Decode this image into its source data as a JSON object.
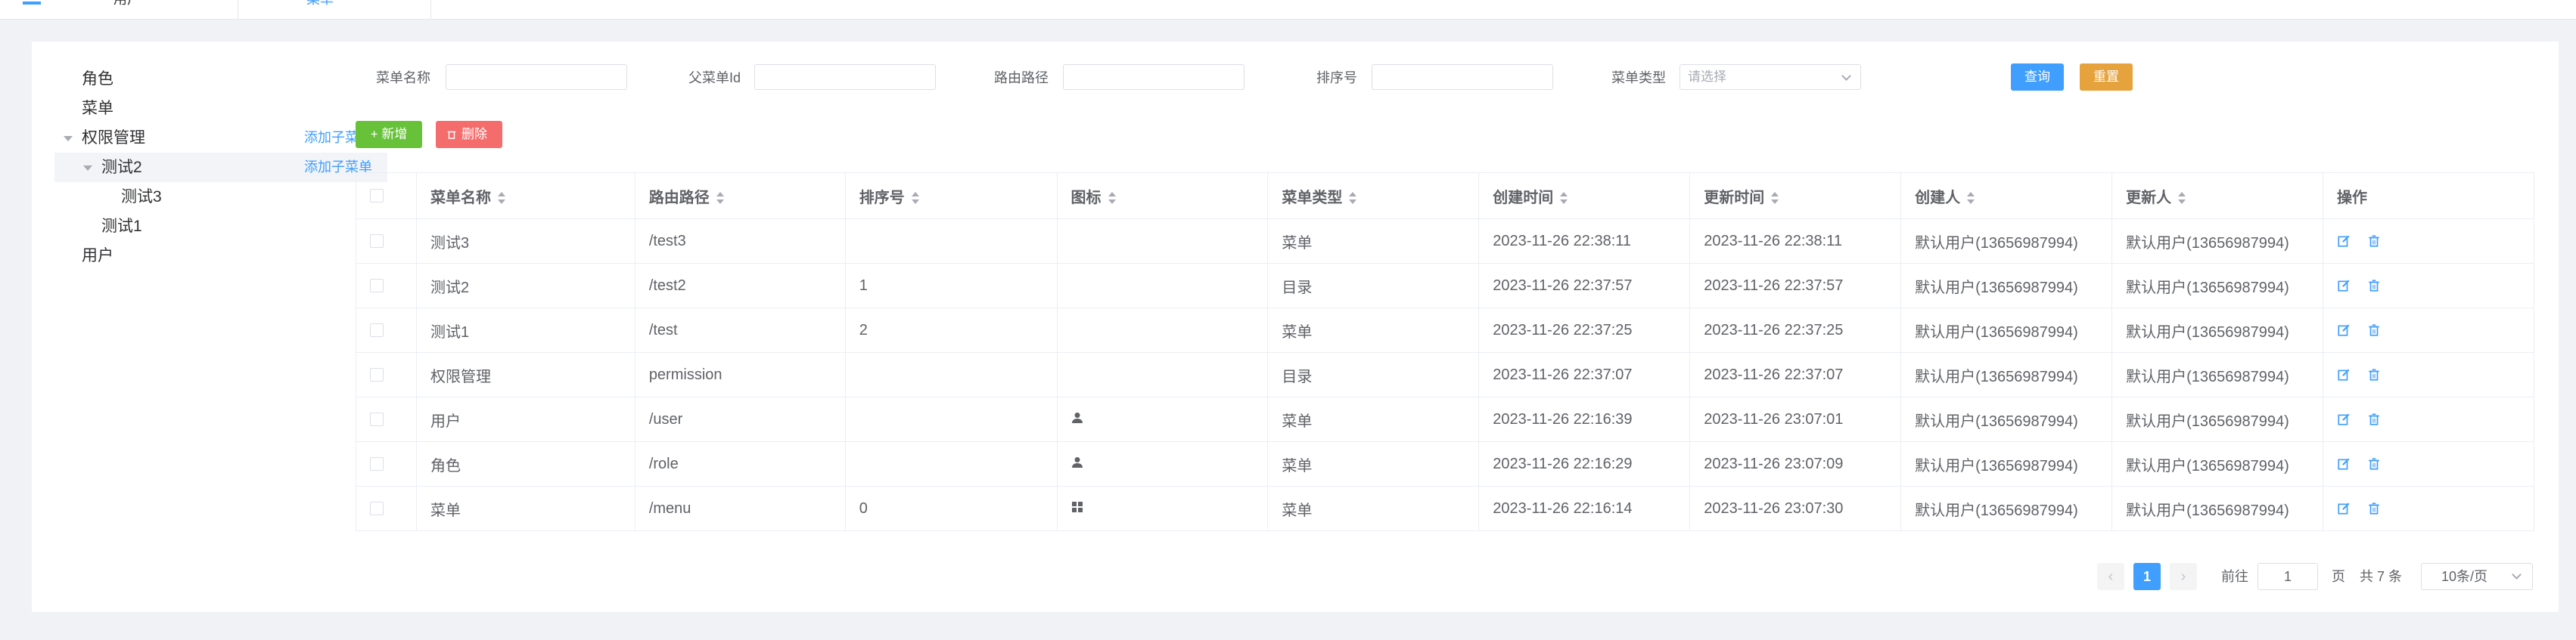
{
  "tabs": [
    {
      "label": "用户"
    },
    {
      "label": "菜单"
    }
  ],
  "tree": {
    "add_child_label": "添加子菜单",
    "nodes": [
      {
        "label": "角色"
      },
      {
        "label": "菜单"
      },
      {
        "label": "权限管理"
      },
      {
        "label": "测试2"
      },
      {
        "label": "测试3"
      },
      {
        "label": "测试1"
      },
      {
        "label": "用户"
      }
    ]
  },
  "filters": {
    "menu_name_label": "菜单名称",
    "parent_id_label": "父菜单Id",
    "route_label": "路由路径",
    "sort_label": "排序号",
    "type_label": "菜单类型",
    "type_placeholder": "请选择",
    "menu_name_value": "",
    "parent_id_value": "",
    "route_value": "",
    "sort_value": ""
  },
  "buttons": {
    "query": "查询",
    "reset": "重置",
    "add": "+ 新增",
    "delete": "删除"
  },
  "table": {
    "columns": [
      "菜单名称",
      "路由路径",
      "排序号",
      "图标",
      "菜单类型",
      "创建时间",
      "更新时间",
      "创建人",
      "更新人",
      "操作"
    ],
    "rows": [
      {
        "name": "测试3",
        "route": "/test3",
        "sort": "",
        "icon": "",
        "type": "菜单",
        "created": "2023-11-26 22:38:11",
        "updated": "2023-11-26 22:38:11",
        "creator": "默认用户(13656987994)",
        "updater": "默认用户(13656987994)"
      },
      {
        "name": "测试2",
        "route": "/test2",
        "sort": "1",
        "icon": "",
        "type": "目录",
        "created": "2023-11-26 22:37:57",
        "updated": "2023-11-26 22:37:57",
        "creator": "默认用户(13656987994)",
        "updater": "默认用户(13656987994)"
      },
      {
        "name": "测试1",
        "route": "/test",
        "sort": "2",
        "icon": "",
        "type": "菜单",
        "created": "2023-11-26 22:37:25",
        "updated": "2023-11-26 22:37:25",
        "creator": "默认用户(13656987994)",
        "updater": "默认用户(13656987994)"
      },
      {
        "name": "权限管理",
        "route": "permission",
        "sort": "",
        "icon": "",
        "type": "目录",
        "created": "2023-11-26 22:37:07",
        "updated": "2023-11-26 22:37:07",
        "creator": "默认用户(13656987994)",
        "updater": "默认用户(13656987994)"
      },
      {
        "name": "用户",
        "route": "/user",
        "sort": "",
        "icon": "user-icon",
        "type": "菜单",
        "created": "2023-11-26 22:16:39",
        "updated": "2023-11-26 23:07:01",
        "creator": "默认用户(13656987994)",
        "updater": "默认用户(13656987994)"
      },
      {
        "name": "角色",
        "route": "/role",
        "sort": "",
        "icon": "user-icon",
        "type": "菜单",
        "created": "2023-11-26 22:16:29",
        "updated": "2023-11-26 23:07:09",
        "creator": "默认用户(13656987994)",
        "updater": "默认用户(13656987994)"
      },
      {
        "name": "菜单",
        "route": "/menu",
        "sort": "0",
        "icon": "grid-icon",
        "type": "菜单",
        "created": "2023-11-26 22:16:14",
        "updated": "2023-11-26 23:07:30",
        "creator": "默认用户(13656987994)",
        "updater": "默认用户(13656987994)"
      }
    ]
  },
  "pagination": {
    "current_page": "1",
    "goto_label": "前往",
    "goto_value": "1",
    "page_unit": "页",
    "total_label": "共 7 条",
    "page_size": "10条/页"
  },
  "colors": {
    "primary": "#409eff",
    "warning": "#e6a23c",
    "success": "#67c23a",
    "danger": "#f56c6c"
  }
}
